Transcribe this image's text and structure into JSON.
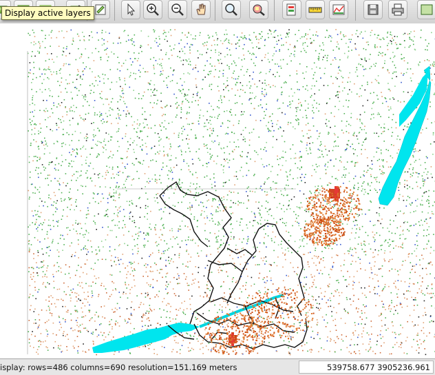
{
  "toolbar": {
    "tooltip": "Display active layers",
    "buttons": [
      {
        "name": "display-active-layers-button",
        "icon": "display-layers-icon"
      },
      {
        "name": "render-button",
        "icon": "render-icon"
      },
      {
        "name": "overlay-button",
        "icon": "overlay-icon"
      },
      {
        "name": "erase-button",
        "icon": "erase-icon"
      },
      {
        "name": "pointer-button",
        "icon": "pointer-icon"
      },
      {
        "name": "zoom-in-button",
        "icon": "zoom-in-icon"
      },
      {
        "name": "zoom-out-button",
        "icon": "zoom-out-icon"
      },
      {
        "name": "pan-button",
        "icon": "pan-hand-icon"
      },
      {
        "name": "zoom-extent-button",
        "icon": "zoom-extent-icon"
      },
      {
        "name": "query-button",
        "icon": "query-icon"
      },
      {
        "name": "analyze-button",
        "icon": "analyze-icon"
      },
      {
        "name": "measure-button",
        "icon": "ruler-icon"
      },
      {
        "name": "profile-button",
        "icon": "profile-icon"
      },
      {
        "name": "save-button",
        "icon": "save-icon"
      },
      {
        "name": "print-button",
        "icon": "print-icon"
      },
      {
        "name": "extra-button",
        "icon": "map-icon"
      }
    ]
  },
  "status": {
    "text": "isplay: rows=486  columns=690  resolution=151.169 meters",
    "coords": "539758.677   3905236.961"
  },
  "map": {
    "water_color": "#00e5ee",
    "city_color": "#cc2200",
    "dot_colors": [
      "#4caf50",
      "#8bd08b",
      "#e0a070",
      "#cc6633",
      "#3355cc",
      "#222222"
    ]
  }
}
